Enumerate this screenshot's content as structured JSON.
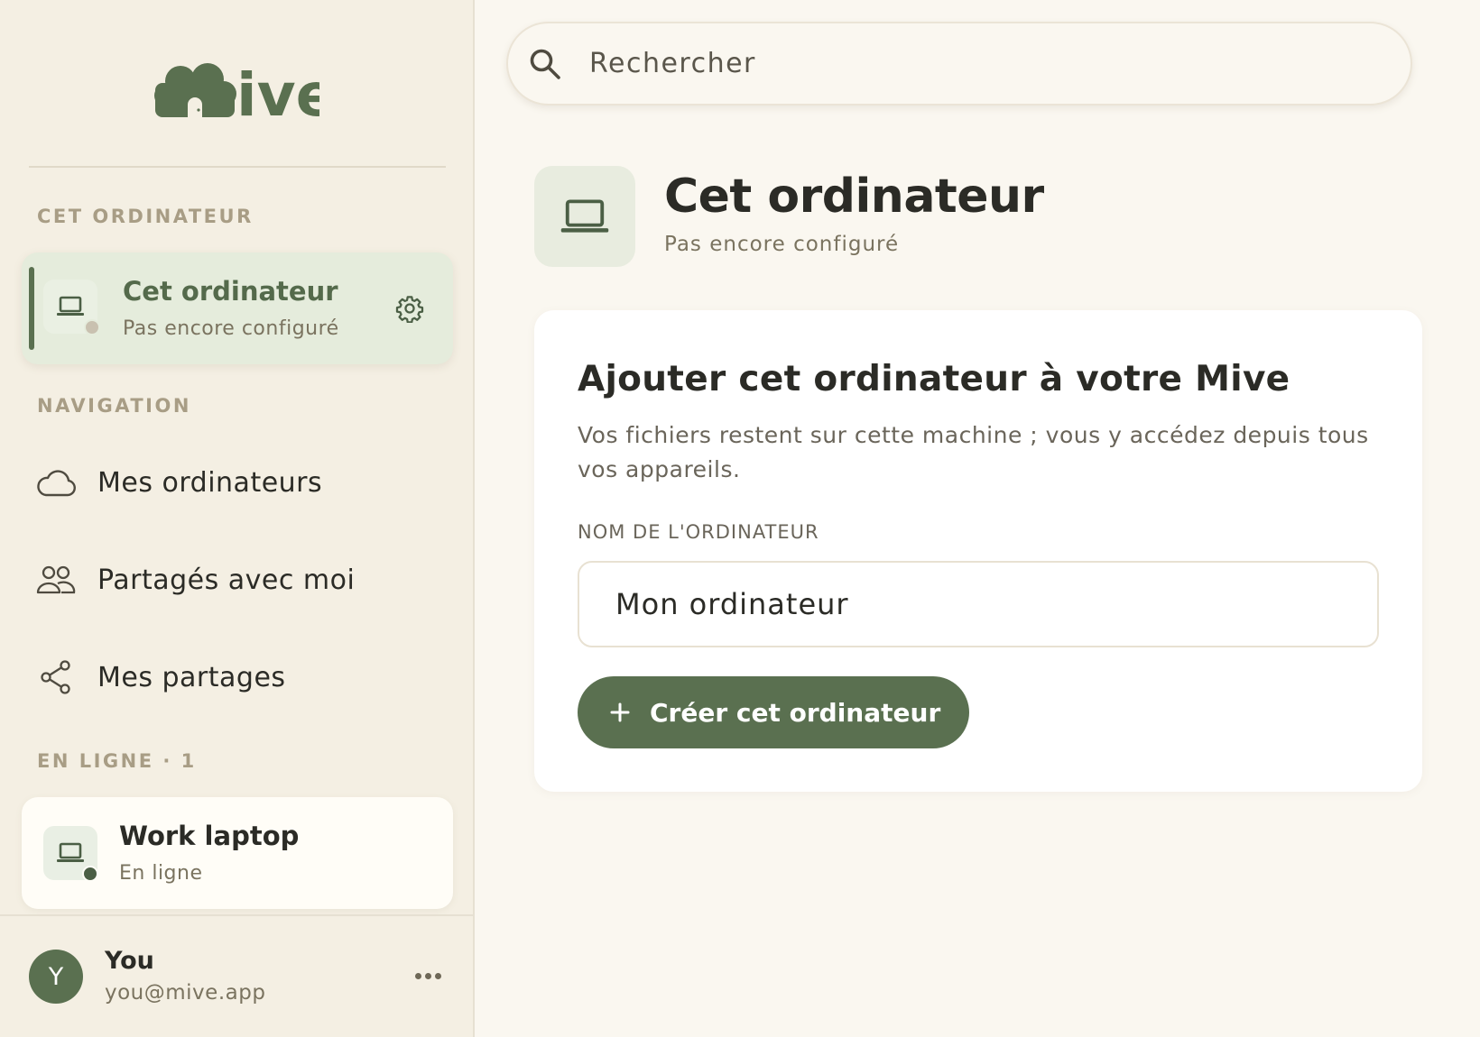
{
  "app": {
    "logo_text": "Mive"
  },
  "sidebar": {
    "this_computer_section": "CET ORDINATEUR",
    "this_computer": {
      "name": "Cet ordinateur",
      "status": "Pas encore configuré"
    },
    "navigation_section": "NAVIGATION",
    "nav_items": [
      {
        "label": "Mes ordinateurs",
        "icon": "cloud-icon"
      },
      {
        "label": "Partagés avec moi",
        "icon": "users-icon"
      },
      {
        "label": "Mes partages",
        "icon": "share-icon"
      }
    ],
    "online_section": "EN LIGNE · 1",
    "online_devices": [
      {
        "name": "Work laptop",
        "status": "En ligne"
      }
    ],
    "user": {
      "initial": "Y",
      "name": "You",
      "email": "you@mive.app"
    }
  },
  "search": {
    "placeholder": "Rechercher"
  },
  "header": {
    "title": "Cet ordinateur",
    "subtitle": "Pas encore configuré"
  },
  "panel": {
    "title": "Ajouter cet ordinateur à votre Mive",
    "description": "Vos fichiers restent sur cette machine ; vous y accédez depuis tous vos appareils.",
    "field_label": "NOM DE L'ORDINATEUR",
    "field_value": "Mon ordinateur",
    "button_label": "Créer cet ordinateur"
  },
  "colors": {
    "accent": "#5a7050",
    "sidebar_bg": "#f4efe3",
    "main_bg": "#faf7f0",
    "active_item_bg": "#e5ecdc",
    "online_dot": "#4b5f45",
    "offline_dot": "#c9c1b0"
  }
}
